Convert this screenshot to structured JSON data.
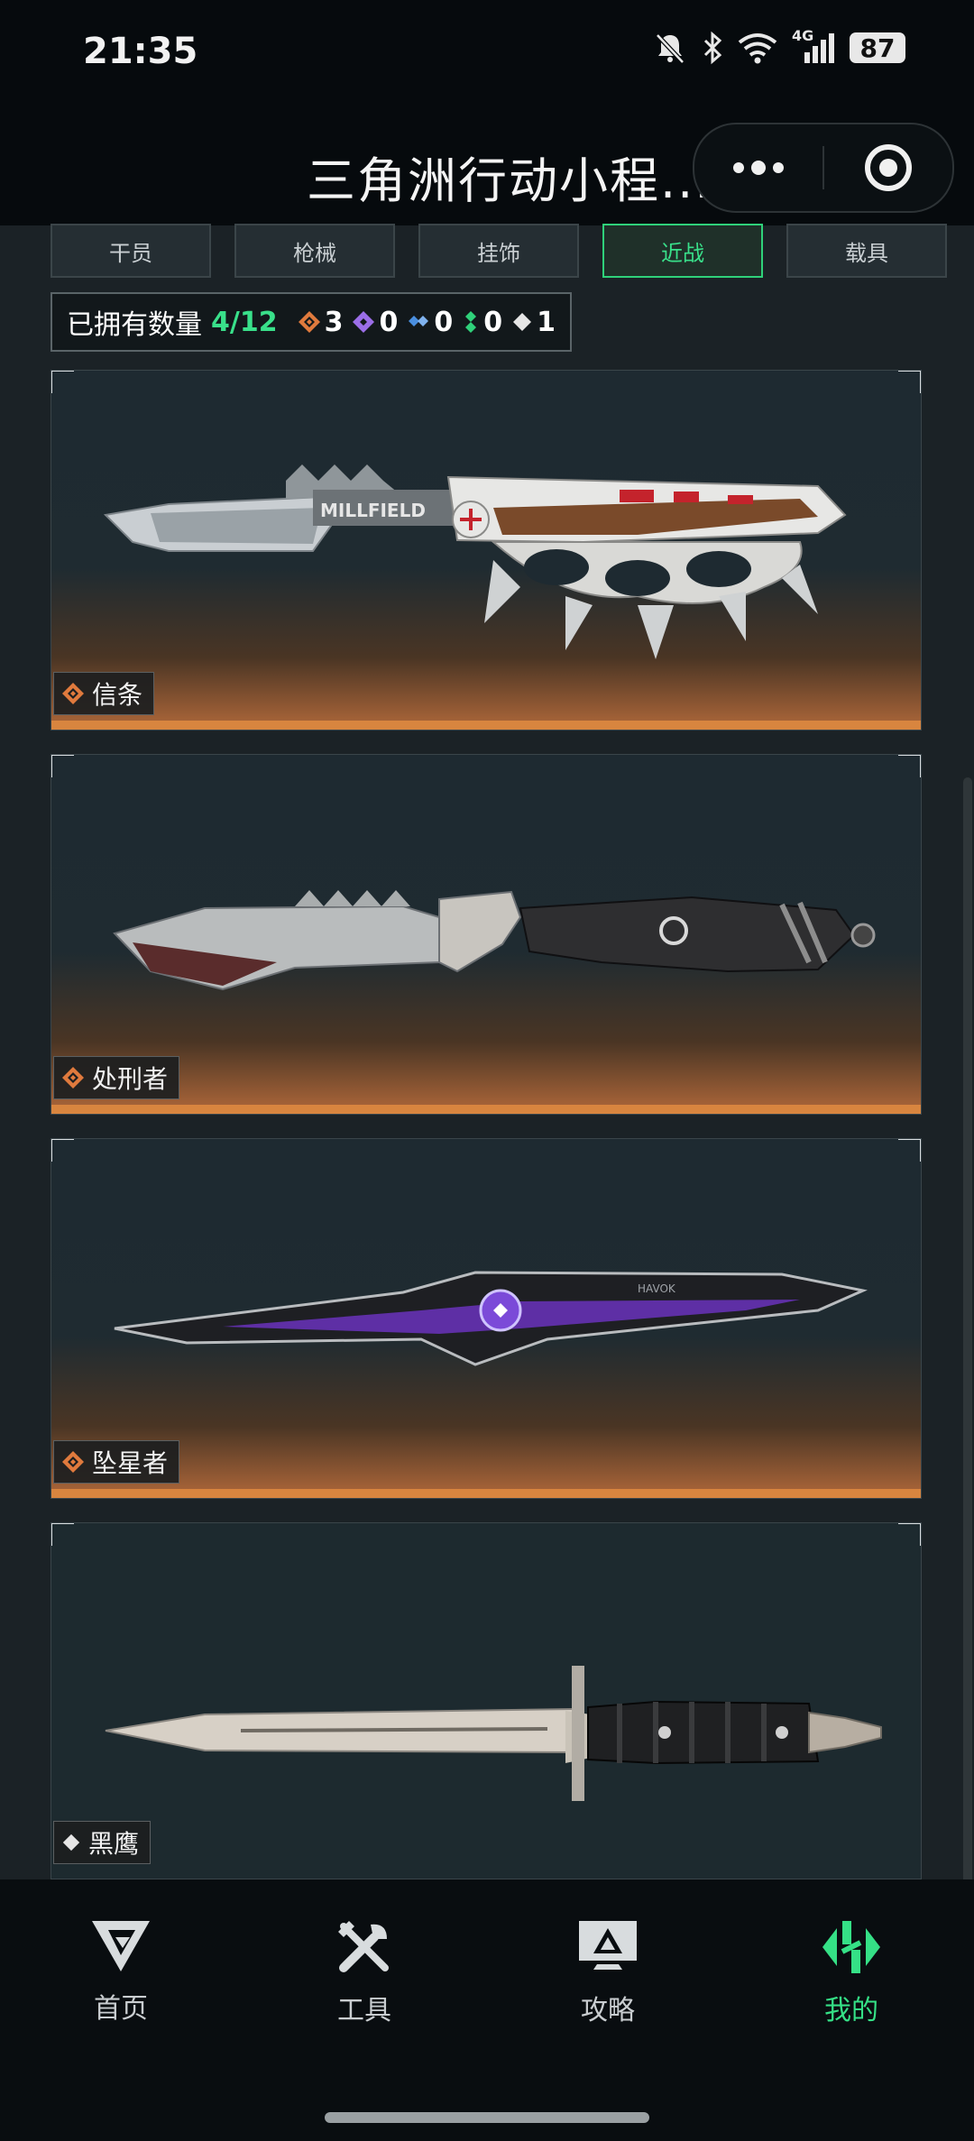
{
  "status_bar": {
    "time": "21:35",
    "network": "4G",
    "battery": "87"
  },
  "title_bar": {
    "title": "三角洲行动小程..."
  },
  "tabs": [
    {
      "label": "干员",
      "active": false
    },
    {
      "label": "枪械",
      "active": false
    },
    {
      "label": "挂饰",
      "active": false
    },
    {
      "label": "近战",
      "active": true
    },
    {
      "label": "载具",
      "active": false
    }
  ],
  "owned": {
    "label": "已拥有数量",
    "count": "4/12",
    "stats": [
      {
        "icon": "orange-diamond-icon",
        "value": "3",
        "color": "#e07a3d"
      },
      {
        "icon": "purple-diamond-icon",
        "value": "0",
        "color": "#9b6ee8"
      },
      {
        "icon": "blue-diamond-icon",
        "value": "0",
        "color": "#4a8fe0"
      },
      {
        "icon": "green-diamond-icon",
        "value": "0",
        "color": "#2fd17a"
      },
      {
        "icon": "white-diamond-icon",
        "value": "1",
        "color": "#e6e6e6"
      }
    ]
  },
  "items": [
    {
      "name": "信条",
      "rarity": "orange"
    },
    {
      "name": "处刑者",
      "rarity": "orange"
    },
    {
      "name": "坠星者",
      "rarity": "orange"
    },
    {
      "name": "黑鹰",
      "rarity": "white"
    }
  ],
  "knife_engravings": {
    "millfield": "MILLFIELD",
    "havok": "HAVOK"
  },
  "bottom_nav": [
    {
      "label": "首页",
      "icon": "home-logo-icon",
      "active": false
    },
    {
      "label": "工具",
      "icon": "tools-icon",
      "active": false
    },
    {
      "label": "攻略",
      "icon": "guide-icon",
      "active": false
    },
    {
      "label": "我的",
      "icon": "profile-logo-icon",
      "active": true
    }
  ],
  "colors": {
    "accent": "#35e086",
    "orange_rarity": "#d8853f",
    "background": "#1b2226"
  }
}
